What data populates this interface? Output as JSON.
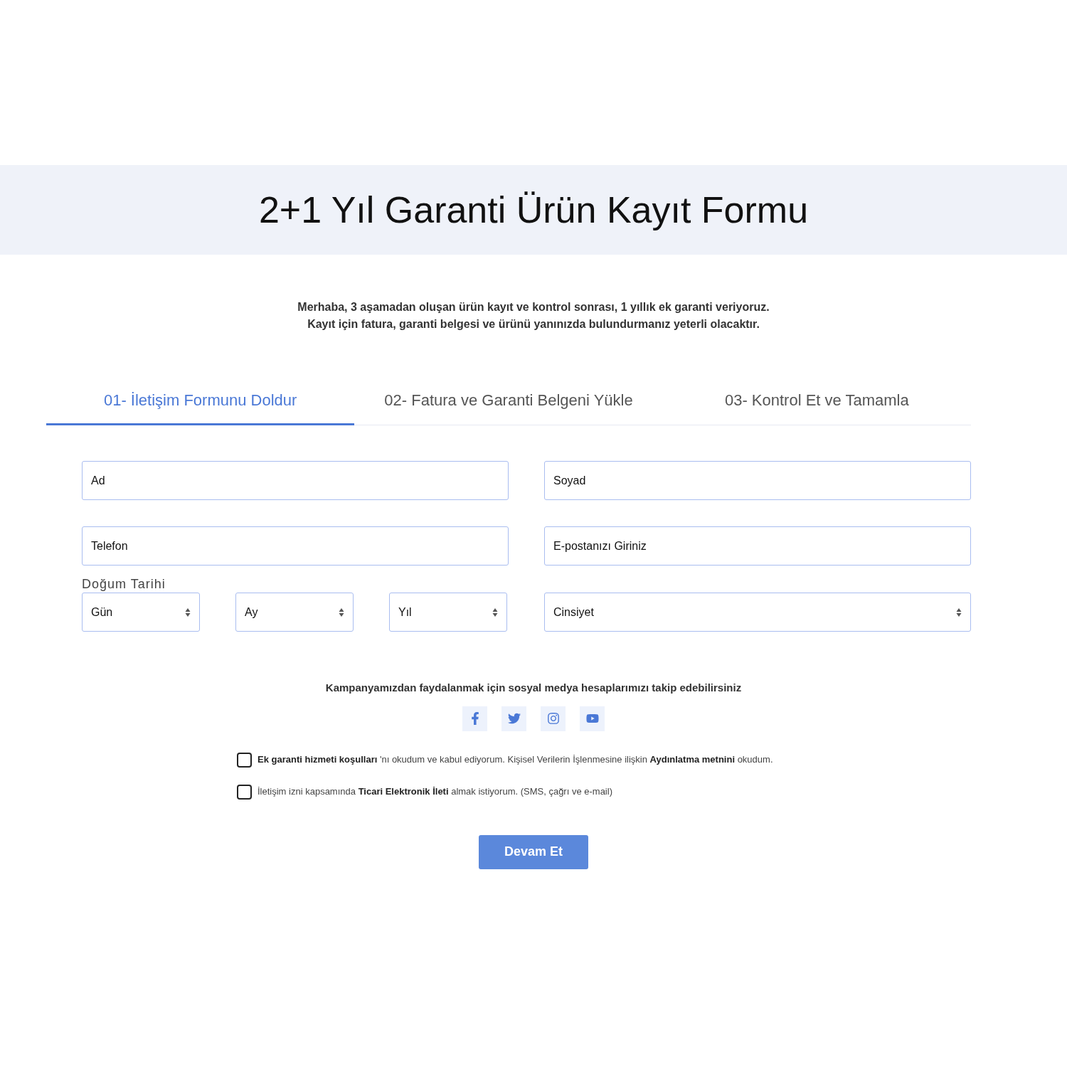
{
  "header": {
    "title": "2+1 Yıl Garanti Ürün Kayıt Formu"
  },
  "intro": [
    "Merhaba, 3 aşamadan oluşan ürün kayıt ve kontrol sonrası, 1 yıllık ek garanti veriyoruz.",
    "Kayıt için fatura, garanti belgesi ve ürünü yanınızda bulundurmanız yeterli olacaktır."
  ],
  "tabs": [
    {
      "label": "01- İletişim Formunu Doldur",
      "selected": true
    },
    {
      "label": "02- Fatura ve Garanti Belgeni Yükle",
      "selected": false
    },
    {
      "label": "03- Kontrol Et ve Tamamla",
      "selected": false
    }
  ],
  "fields": [
    {
      "placeholder": "Ad"
    },
    {
      "placeholder": "Soyad"
    },
    {
      "placeholder": "Telefon"
    },
    {
      "placeholder": "E-postanızı Giriniz"
    }
  ],
  "birth_date": {
    "label": "Doğum Tarihi",
    "selects": [
      {
        "placeholder": "Gün"
      },
      {
        "placeholder": "Ay"
      },
      {
        "placeholder": "Yıl"
      }
    ]
  },
  "gender_select": {
    "placeholder": "Cinsiyet"
  },
  "social": {
    "text": "Kampanyamızdan faydalanmak için sosyal medya hesaplarımızı takip edebilirsiniz",
    "icons": [
      {
        "kind": "facebook"
      },
      {
        "kind": "twitter"
      },
      {
        "kind": "instagram"
      },
      {
        "kind": "youtube"
      }
    ]
  },
  "consents": [
    {
      "text": "**Ek garanti hizmeti koşulları** 'nı okudum ve kabul ediyorum. Kişisel Verilerin İşlenmesine ilişkin **Aydınlatma metnini** okudum.",
      "checked": false
    },
    {
      "text": "İletişim izni kapsamında **Ticari Elektronik İleti** almak istiyorum. (SMS, çağrı ve e-mail)",
      "checked": false
    }
  ],
  "submit": "Devam Et"
}
